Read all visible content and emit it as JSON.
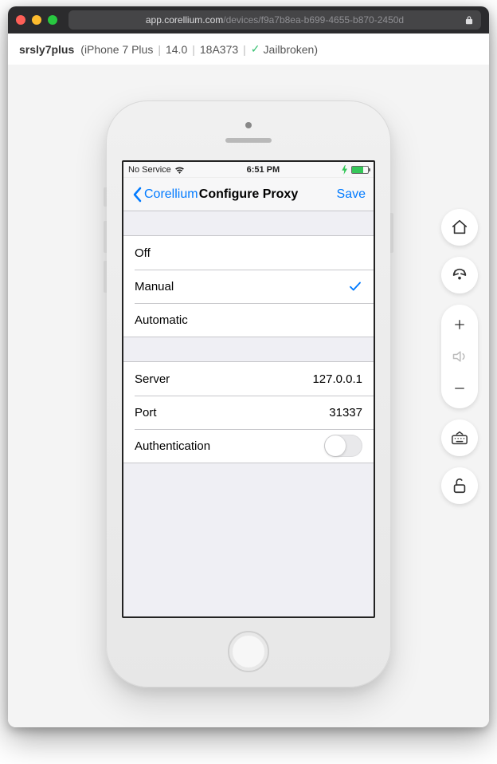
{
  "browser": {
    "url_domain": "app.corellium.com",
    "url_path": "/devices/f9a7b8ea-b699-4655-b870-2450d"
  },
  "device_header": {
    "name": "srsly7plus",
    "model": "iPhone 7 Plus",
    "os_version": "14.0",
    "build": "18A373",
    "status": "Jailbroken"
  },
  "ios": {
    "status_left_text": "No Service",
    "status_time": "6:51 PM",
    "nav_back_label": "Corellium",
    "nav_title": "Configure Proxy",
    "nav_save_label": "Save",
    "proxy_modes": {
      "off": "Off",
      "manual": "Manual",
      "automatic": "Automatic",
      "selected": "manual"
    },
    "server_label": "Server",
    "server_value": "127.0.0.1",
    "port_label": "Port",
    "port_value": "31337",
    "auth_label": "Authentication",
    "auth_enabled": false
  }
}
